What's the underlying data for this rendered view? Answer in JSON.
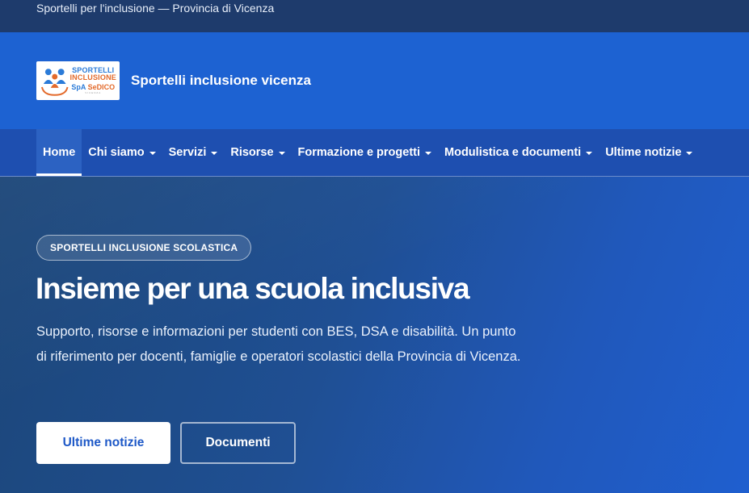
{
  "topbar": {
    "text": "Sportelli per l'inclusione — Provincia di Vicenza"
  },
  "header": {
    "logo": {
      "line1": "SPORTELLI",
      "line2": "INCLUSIONE",
      "line3a": "SpA",
      "line3b": "SeDICO",
      "line4": "VICENZA",
      "icon": "people-hands-icon"
    },
    "site_title": "Sportelli inclusione vicenza"
  },
  "nav": {
    "items": [
      {
        "label": "Home",
        "active": true,
        "dropdown": false
      },
      {
        "label": "Chi siamo",
        "dropdown": true
      },
      {
        "label": "Servizi",
        "dropdown": true
      },
      {
        "label": "Risorse",
        "dropdown": true
      },
      {
        "label": "Formazione e progetti",
        "dropdown": true
      },
      {
        "label": "Modulistica e documenti",
        "dropdown": true
      },
      {
        "label": "Ultime notizie",
        "dropdown": true
      }
    ]
  },
  "hero": {
    "badge": "SPORTELLI INCLUSIONE SCOLASTICA",
    "headline": "Insieme per una scuola inclusiva",
    "lead": "Supporto, risorse e informazioni per studenti con BES, DSA e disabilità. Un punto di riferimento per docenti, famiglie e operatori scolastici della Provincia di Vicenza.",
    "primary_button": "Ultime notizie",
    "secondary_button": "Documenti"
  },
  "colors": {
    "topbar": "#1e3b6c",
    "header": "#1d62d2",
    "nav": "#1e4fb0",
    "primary_button_text": "#1d58c7"
  }
}
